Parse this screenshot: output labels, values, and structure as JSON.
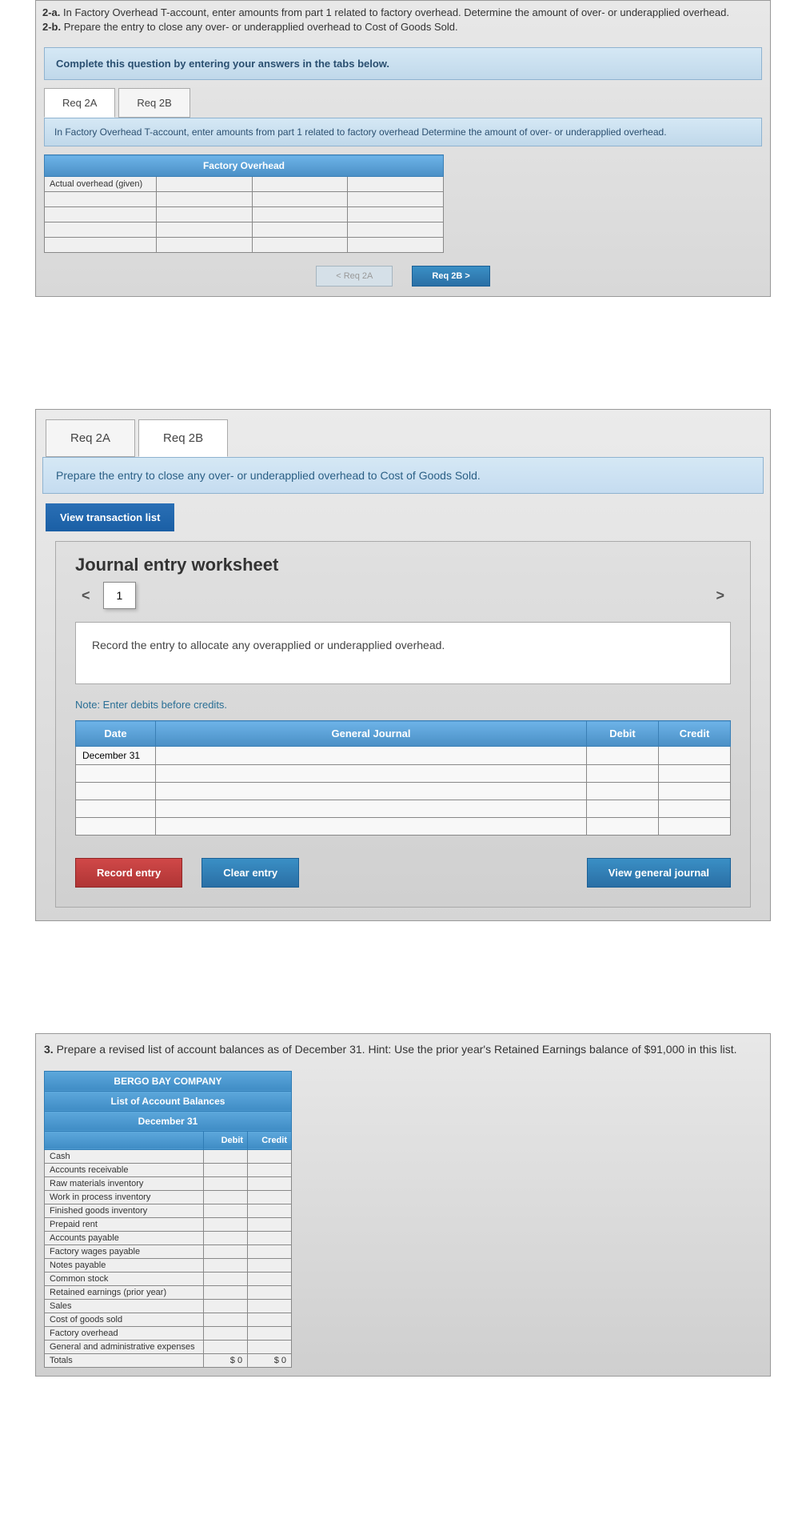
{
  "panel1": {
    "q2a_label": "2-a.",
    "q2a_text": "In Factory Overhead T-account, enter amounts from part 1 related to factory overhead. Determine the amount of over- or underapplied overhead.",
    "q2b_label": "2-b.",
    "q2b_text": "Prepare the entry to close any over- or underapplied overhead to Cost of Goods Sold.",
    "blue_bar": "Complete this question by entering your answers in the tabs below.",
    "tab_a": "Req 2A",
    "tab_b": "Req 2B",
    "instruction": "In Factory Overhead T-account, enter amounts from part 1 related to factory overhead Determine the amount of over- or underapplied overhead.",
    "table_header": "Factory Overhead",
    "row_label": "Actual overhead (given)",
    "nav_prev": "< Req 2A",
    "nav_next": "Req 2B  >"
  },
  "panel2": {
    "tab_a": "Req 2A",
    "tab_b": "Req 2B",
    "instruction": "Prepare the entry to close any over- or underapplied overhead to Cost of Goods Sold.",
    "view_tx": "View transaction list",
    "title": "Journal entry worksheet",
    "step": "1",
    "record_instruction": "Record the entry to allocate any overapplied or underapplied overhead.",
    "note": "Note: Enter debits before credits.",
    "headers": {
      "date": "Date",
      "gj": "General Journal",
      "debit": "Debit",
      "credit": "Credit"
    },
    "date_value": "December 31",
    "btn_record": "Record entry",
    "btn_clear": "Clear entry",
    "btn_view": "View general journal"
  },
  "panel3": {
    "q_label": "3.",
    "q_text": "Prepare a revised list of account balances as of December 31. Hint: Use the prior year's Retained Earnings balance of $91,000 in this list.",
    "title1": "BERGO BAY COMPANY",
    "title2": "List of Account Balances",
    "title3": "December 31",
    "headers": {
      "debit": "Debit",
      "credit": "Credit"
    },
    "accounts": [
      "Cash",
      "Accounts receivable",
      "Raw materials inventory",
      "Work in process inventory",
      "Finished goods inventory",
      "Prepaid rent",
      "Accounts payable",
      "Factory wages payable",
      "Notes payable",
      "Common stock",
      "Retained earnings (prior year)",
      "Sales",
      "Cost of goods sold",
      "Factory overhead",
      "General and administrative expenses"
    ],
    "totals_label": "Totals",
    "totals_debit": "$              0",
    "totals_credit": "$              0"
  }
}
